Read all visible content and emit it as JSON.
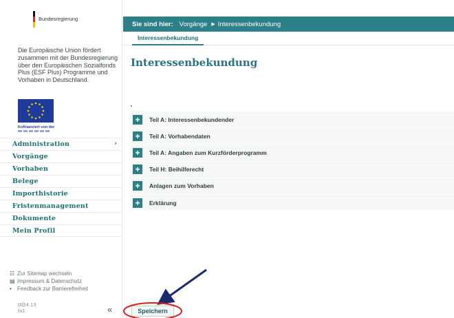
{
  "logo": {
    "text": "Bundesregierung"
  },
  "sidebar": {
    "eu_text": "Die Europäische Union fördert zusammen mit der Bundesregierung über den Europäischen Sozialfonds Plus (ESF Plus) Programme und Vorhaben in Deutschland.",
    "cofinanced": "Kofinanziert von der",
    "nav": [
      {
        "label": "Administration",
        "has_chevron": true
      },
      {
        "label": "Vorgänge"
      },
      {
        "label": "Vorhaben"
      },
      {
        "label": "Belege"
      },
      {
        "label": "Importhistorie"
      },
      {
        "label": "Fristenmanagement"
      },
      {
        "label": "Dokumente"
      },
      {
        "label": "Mein Profil"
      }
    ],
    "footer_links": [
      {
        "label": "Zur Sitemap wechseln",
        "icon": "sitemap-icon"
      },
      {
        "label": "Impressum & Datenschutz",
        "icon": "document-icon"
      },
      {
        "label": "Feedback zur Barrierefreiheit",
        "icon": "feedback-icon"
      }
    ],
    "version_line1": "d@4.13",
    "version_line2": "fa1",
    "collapse_label": "«"
  },
  "header": {
    "label": "Sie sind hier:",
    "crumbs": [
      "Vorgänge",
      "Interessenbekundung"
    ],
    "separator": "▶"
  },
  "tabs": [
    {
      "label": "Interessenbekundung",
      "active": true
    }
  ],
  "main": {
    "title": "Interessenbekundung",
    "sections": [
      "Teil A: Interessenbekundender",
      "Teil A: Vorhabendaten",
      "Teil A: Angaben zum Kurzförderprogramm",
      "Teil H: Beihilferecht",
      "Anlagen zum Vorhaben",
      "Erklärung"
    ],
    "expand_symbol": "+",
    "save_label": "Speichern"
  },
  "colors": {
    "accent": "#2d7f88",
    "eu_blue": "#1f3b9a",
    "annotation": "#d62020"
  }
}
